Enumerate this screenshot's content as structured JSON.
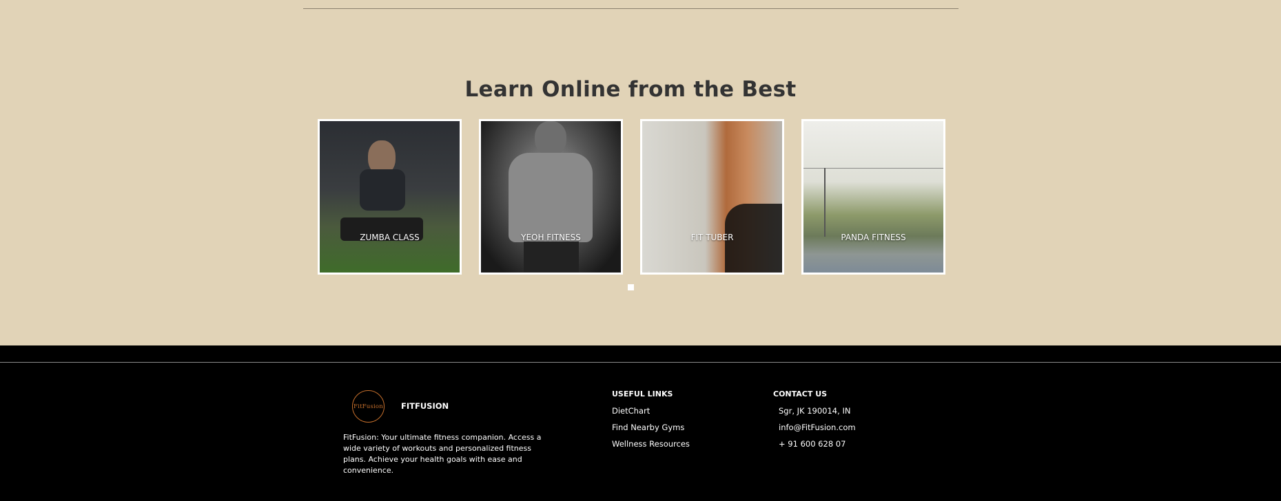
{
  "section": {
    "title": "Learn Online from the Best"
  },
  "cards": [
    {
      "caption": "ZUMBA CLASS"
    },
    {
      "caption": "YEOH FITNESS"
    },
    {
      "caption": "FIT TUBER"
    },
    {
      "caption": "PANDA FITNESS"
    }
  ],
  "footer": {
    "logo_text": "FitFusion",
    "brand": "FITFUSION",
    "about": "FitFusion: Your ultimate fitness companion. Access a wide variety of workouts and personalized fitness plans. Achieve your health goals with ease and convenience.",
    "useful_links": {
      "heading": "USEFUL LINKS",
      "items": [
        "DietChart",
        "Find Nearby Gyms",
        "Wellness Resources"
      ]
    },
    "contact": {
      "heading": "CONTACT US",
      "address": "Sgr, JK 190014, IN",
      "email": "info@FitFusion.com",
      "phone": "+ 91 600 628 07"
    }
  },
  "colors": {
    "page_bg": "#e1d3b7",
    "footer_bg": "#000000",
    "logo_accent": "#c7702c",
    "title_text": "#333333"
  }
}
